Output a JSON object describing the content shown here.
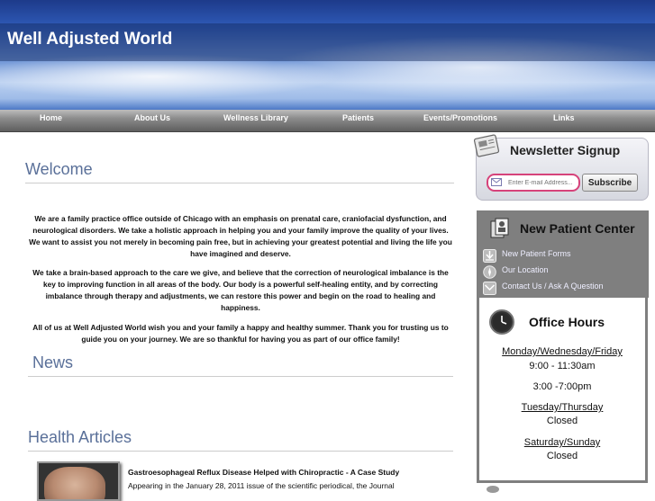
{
  "site": {
    "title": "Well Adjusted World"
  },
  "nav": [
    "Home",
    "About Us",
    "Wellness Library",
    "Patients",
    "Events/Promotions",
    "Links"
  ],
  "welcome": {
    "heading": "Welcome",
    "paragraphs": [
      "We are a family practice office outside of Chicago with an emphasis on prenatal care, craniofacial dysfunction, and neurological disorders.  We take a holistic approach in helping you and your family improve the quality of your lives.  We want to assist you not merely in becoming pain free, but in achieving your greatest potential and living the life you have imagined and deserve.",
      "We take a brain-based approach to the care we give, and believe that the correction of neurological imbalance is the key to improving function in all areas of the body.  Our body is a powerful self-healing entity, and by correcting imbalance through therapy and adjustments, we can restore this power and begin on the road to healing and happiness.",
      "All of us at Well Adjusted World wish you and your family a happy and healthy summer.  Thank you for trusting us to guide you on your journey.  We are so thankful for having you as part of our office family!"
    ]
  },
  "news": {
    "heading": "News"
  },
  "health": {
    "heading": "Health Articles",
    "article_title": "Gastroesophageal Reflux Disease Helped with Chiropractic - A Case Study",
    "article_snippet": "Appearing in the January 28, 2011 issue of the scientific periodical, the Journal"
  },
  "newsletter": {
    "title": "Newsletter Signup",
    "placeholder": "Enter E-mail Address...",
    "button": "Subscribe"
  },
  "new_patient": {
    "title": "New Patient Center",
    "links": [
      "New Patient Forms",
      "Our Location",
      "Contact Us / Ask A Question"
    ]
  },
  "office_hours": {
    "title": "Office Hours",
    "lines": [
      {
        "text": "Monday/Wednesday/Friday",
        "underline": true
      },
      {
        "text": "9:00 - 11:30am",
        "underline": false
      },
      {
        "text": "3:00 -7:00pm",
        "underline": false
      },
      {
        "text": "Tuesday/Thursday",
        "underline": true
      },
      {
        "text": "Closed",
        "underline": false
      },
      {
        "text": "Saturday/Sunday",
        "underline": true
      },
      {
        "text": "Closed",
        "underline": false
      }
    ]
  }
}
